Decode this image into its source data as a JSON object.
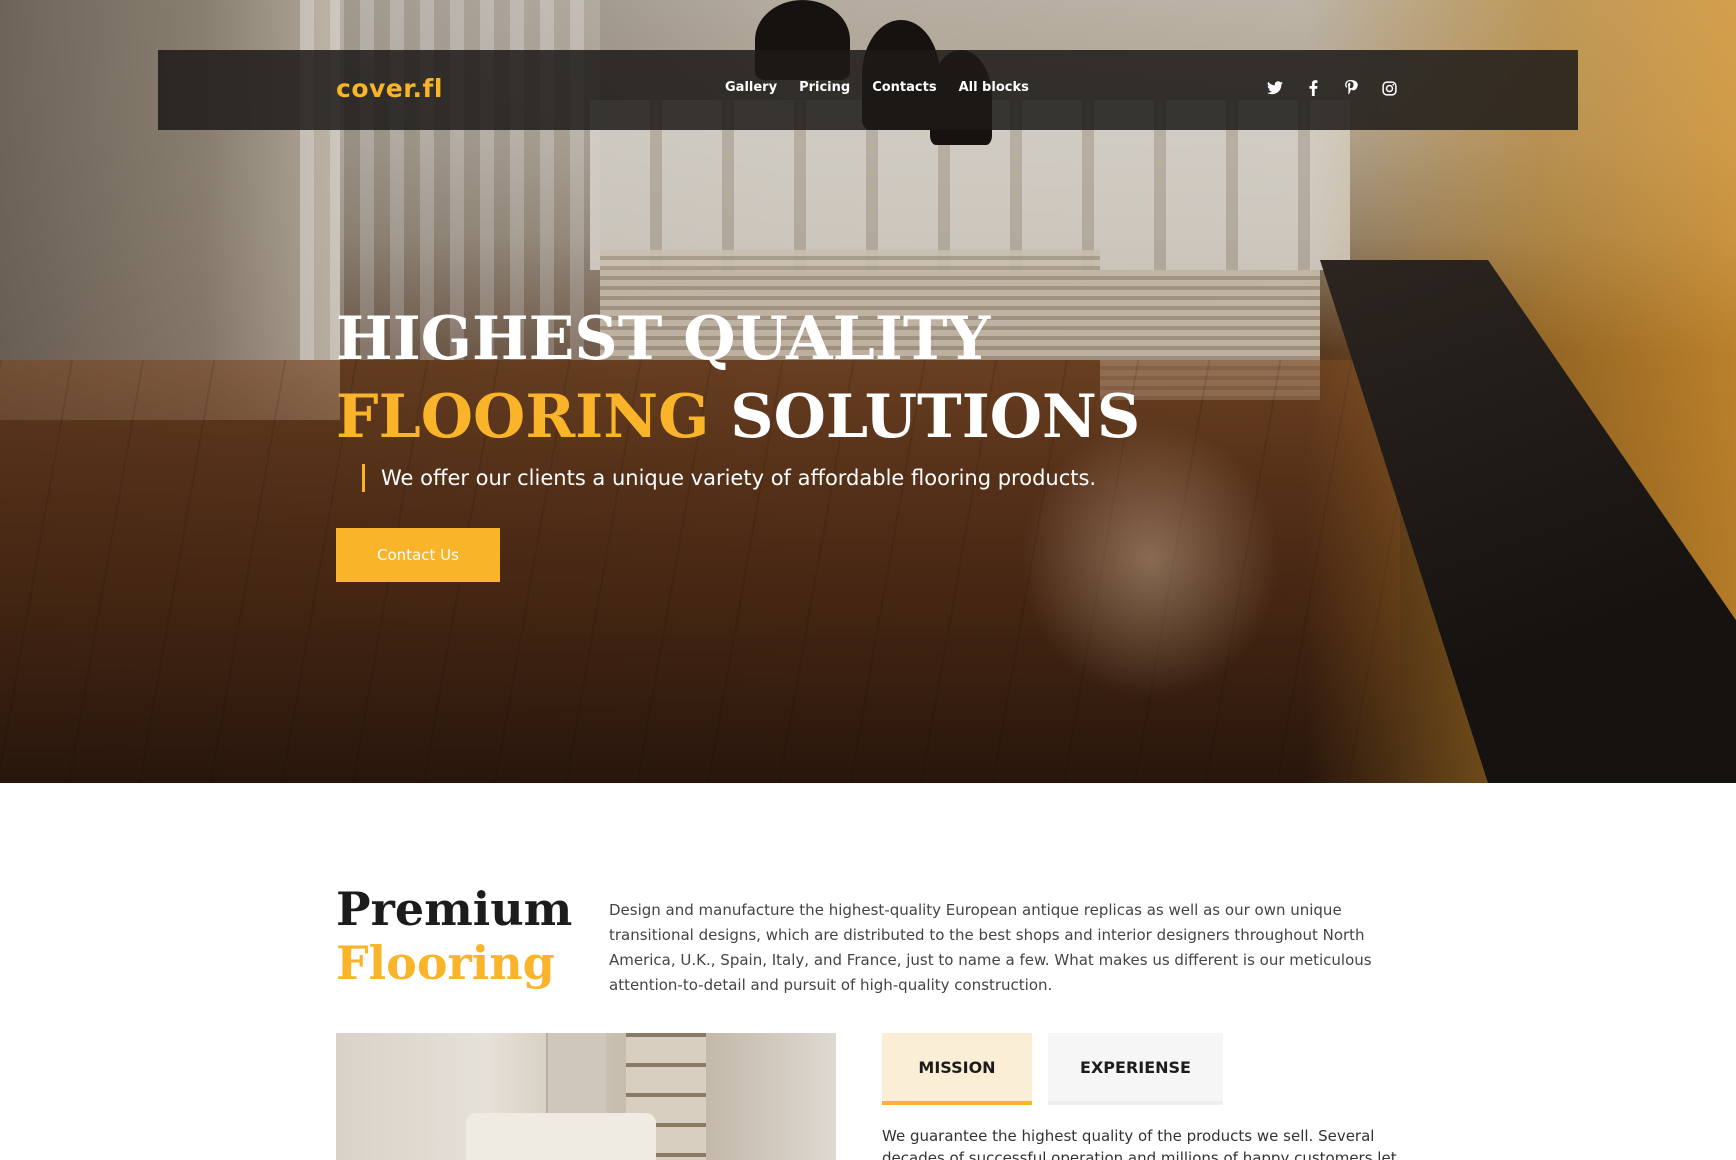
{
  "brand": {
    "logo": "cover.fl",
    "accent_color": "#f9b429"
  },
  "nav": {
    "links": [
      {
        "label": "Gallery"
      },
      {
        "label": "Pricing"
      },
      {
        "label": "Contacts"
      },
      {
        "label": "All blocks"
      }
    ],
    "socials": [
      "twitter-icon",
      "facebook-icon",
      "pinterest-icon",
      "instagram-icon"
    ]
  },
  "hero": {
    "title_line1": "HIGHEST QUALITY",
    "title_accent": "FLOORING",
    "title_rest": " SOLUTIONS",
    "subtitle": "We offer our clients a unique variety of affordable flooring products.",
    "cta_label": "Contact Us"
  },
  "premium": {
    "title_line1": "Premium",
    "title_line2": "Flooring",
    "description": "Design and manufacture the highest-quality European antique replicas as well as our own unique transitional designs, which are distributed to the best shops and interior designers throughout North America, U.K., Spain, Italy, and France, just to name a few. What makes us different is our meticulous attention-to-detail and pursuit of high-quality construction."
  },
  "tabs": {
    "items": [
      {
        "label": "MISSION",
        "active": true
      },
      {
        "label": "EXPERIENSE",
        "active": false
      }
    ],
    "content": "We guarantee the highest quality of the products we sell. Several decades of successful operation and millions of happy customers let"
  }
}
